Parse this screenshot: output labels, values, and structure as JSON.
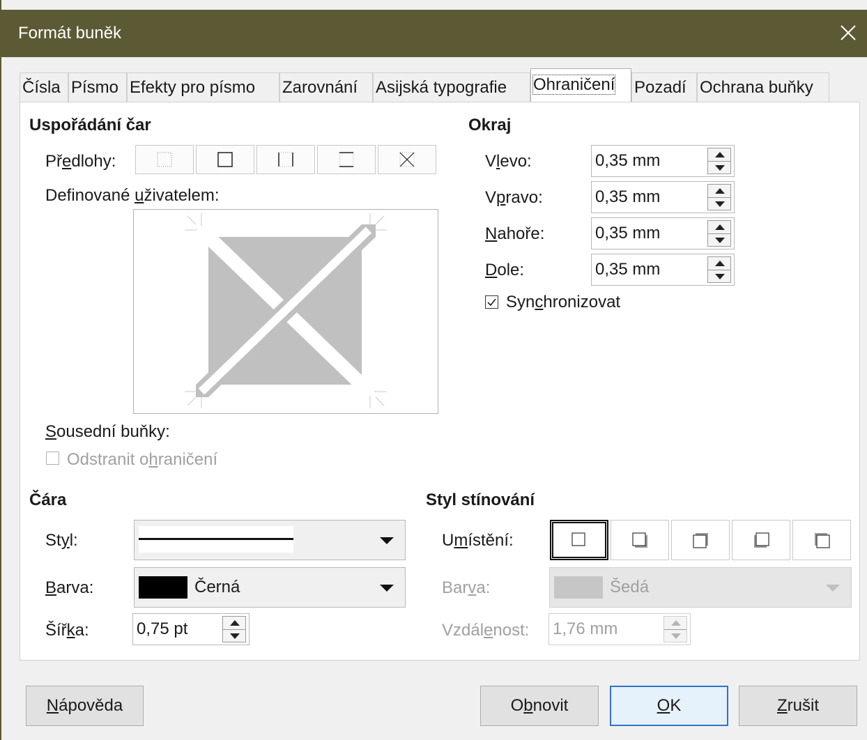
{
  "window": {
    "title": "Formát buněk"
  },
  "tabs": [
    {
      "label": "Čísla"
    },
    {
      "label": "Písmo"
    },
    {
      "label": "Efekty pro písmo"
    },
    {
      "label": "Zarovnání"
    },
    {
      "label": "Asijská typografie"
    },
    {
      "label": "Ohraničení"
    },
    {
      "label": "Pozadí"
    },
    {
      "label": "Ochrana buňky"
    }
  ],
  "line_arrangement": {
    "heading": "Uspořádání čar",
    "presets_label_a": "Př",
    "presets_label_u": "e",
    "presets_label_b": "dlohy:",
    "user_defined_a": "Definované ",
    "user_defined_u": "u",
    "user_defined_b": "živatelem:"
  },
  "padding": {
    "heading": "Okraj",
    "rows": [
      {
        "pre": "V",
        "u": "l",
        "post": "evo:",
        "value": "0,35 mm"
      },
      {
        "pre": "V",
        "u": "p",
        "post": "ravo:",
        "value": "0,35 mm"
      },
      {
        "pre": "",
        "u": "N",
        "post": "ahoře:",
        "value": "0,35 mm"
      },
      {
        "pre": "",
        "u": "D",
        "post": "ole:",
        "value": "0,35 mm"
      }
    ],
    "sync_a": "Syn",
    "sync_u": "c",
    "sync_b": "hronizovat",
    "sync_checked": true
  },
  "adjacent": {
    "label_u": "S",
    "label_b": "ousední buňky:",
    "remove_a": "Odstranit o",
    "remove_u": "h",
    "remove_b": "raničení",
    "remove_checked": false
  },
  "line": {
    "heading": "Čára",
    "style_a": "St",
    "style_u": "y",
    "style_b": "l:",
    "color_u": "B",
    "color_b": "arva:",
    "color_value": "Černá",
    "color_swatch": "#000000",
    "width_a": "Šíř",
    "width_u": "k",
    "width_b": "a:",
    "width_value": "0,75 pt"
  },
  "shadow": {
    "heading": "Styl stínování",
    "position_a": "U",
    "position_u": "m",
    "position_b": "ístění:",
    "color_a": "Bar",
    "color_u": "v",
    "color_b": "a:",
    "color_value": "Šedá",
    "distance_a": "Vzdál",
    "distance_u": "e",
    "distance_b": "nost:",
    "distance_value": "1,76 mm"
  },
  "buttons": {
    "help_u": "N",
    "help_b": "ápověda",
    "reset_a": "O",
    "reset_u": "b",
    "reset_b": "novit",
    "ok_u": "O",
    "ok_b": "K",
    "cancel_u": "Z",
    "cancel_b": "rušit"
  },
  "colors": {
    "titlebar": "#5b5a34",
    "accent": "#2f74c9",
    "preview_fill": "#c0c0c0"
  }
}
